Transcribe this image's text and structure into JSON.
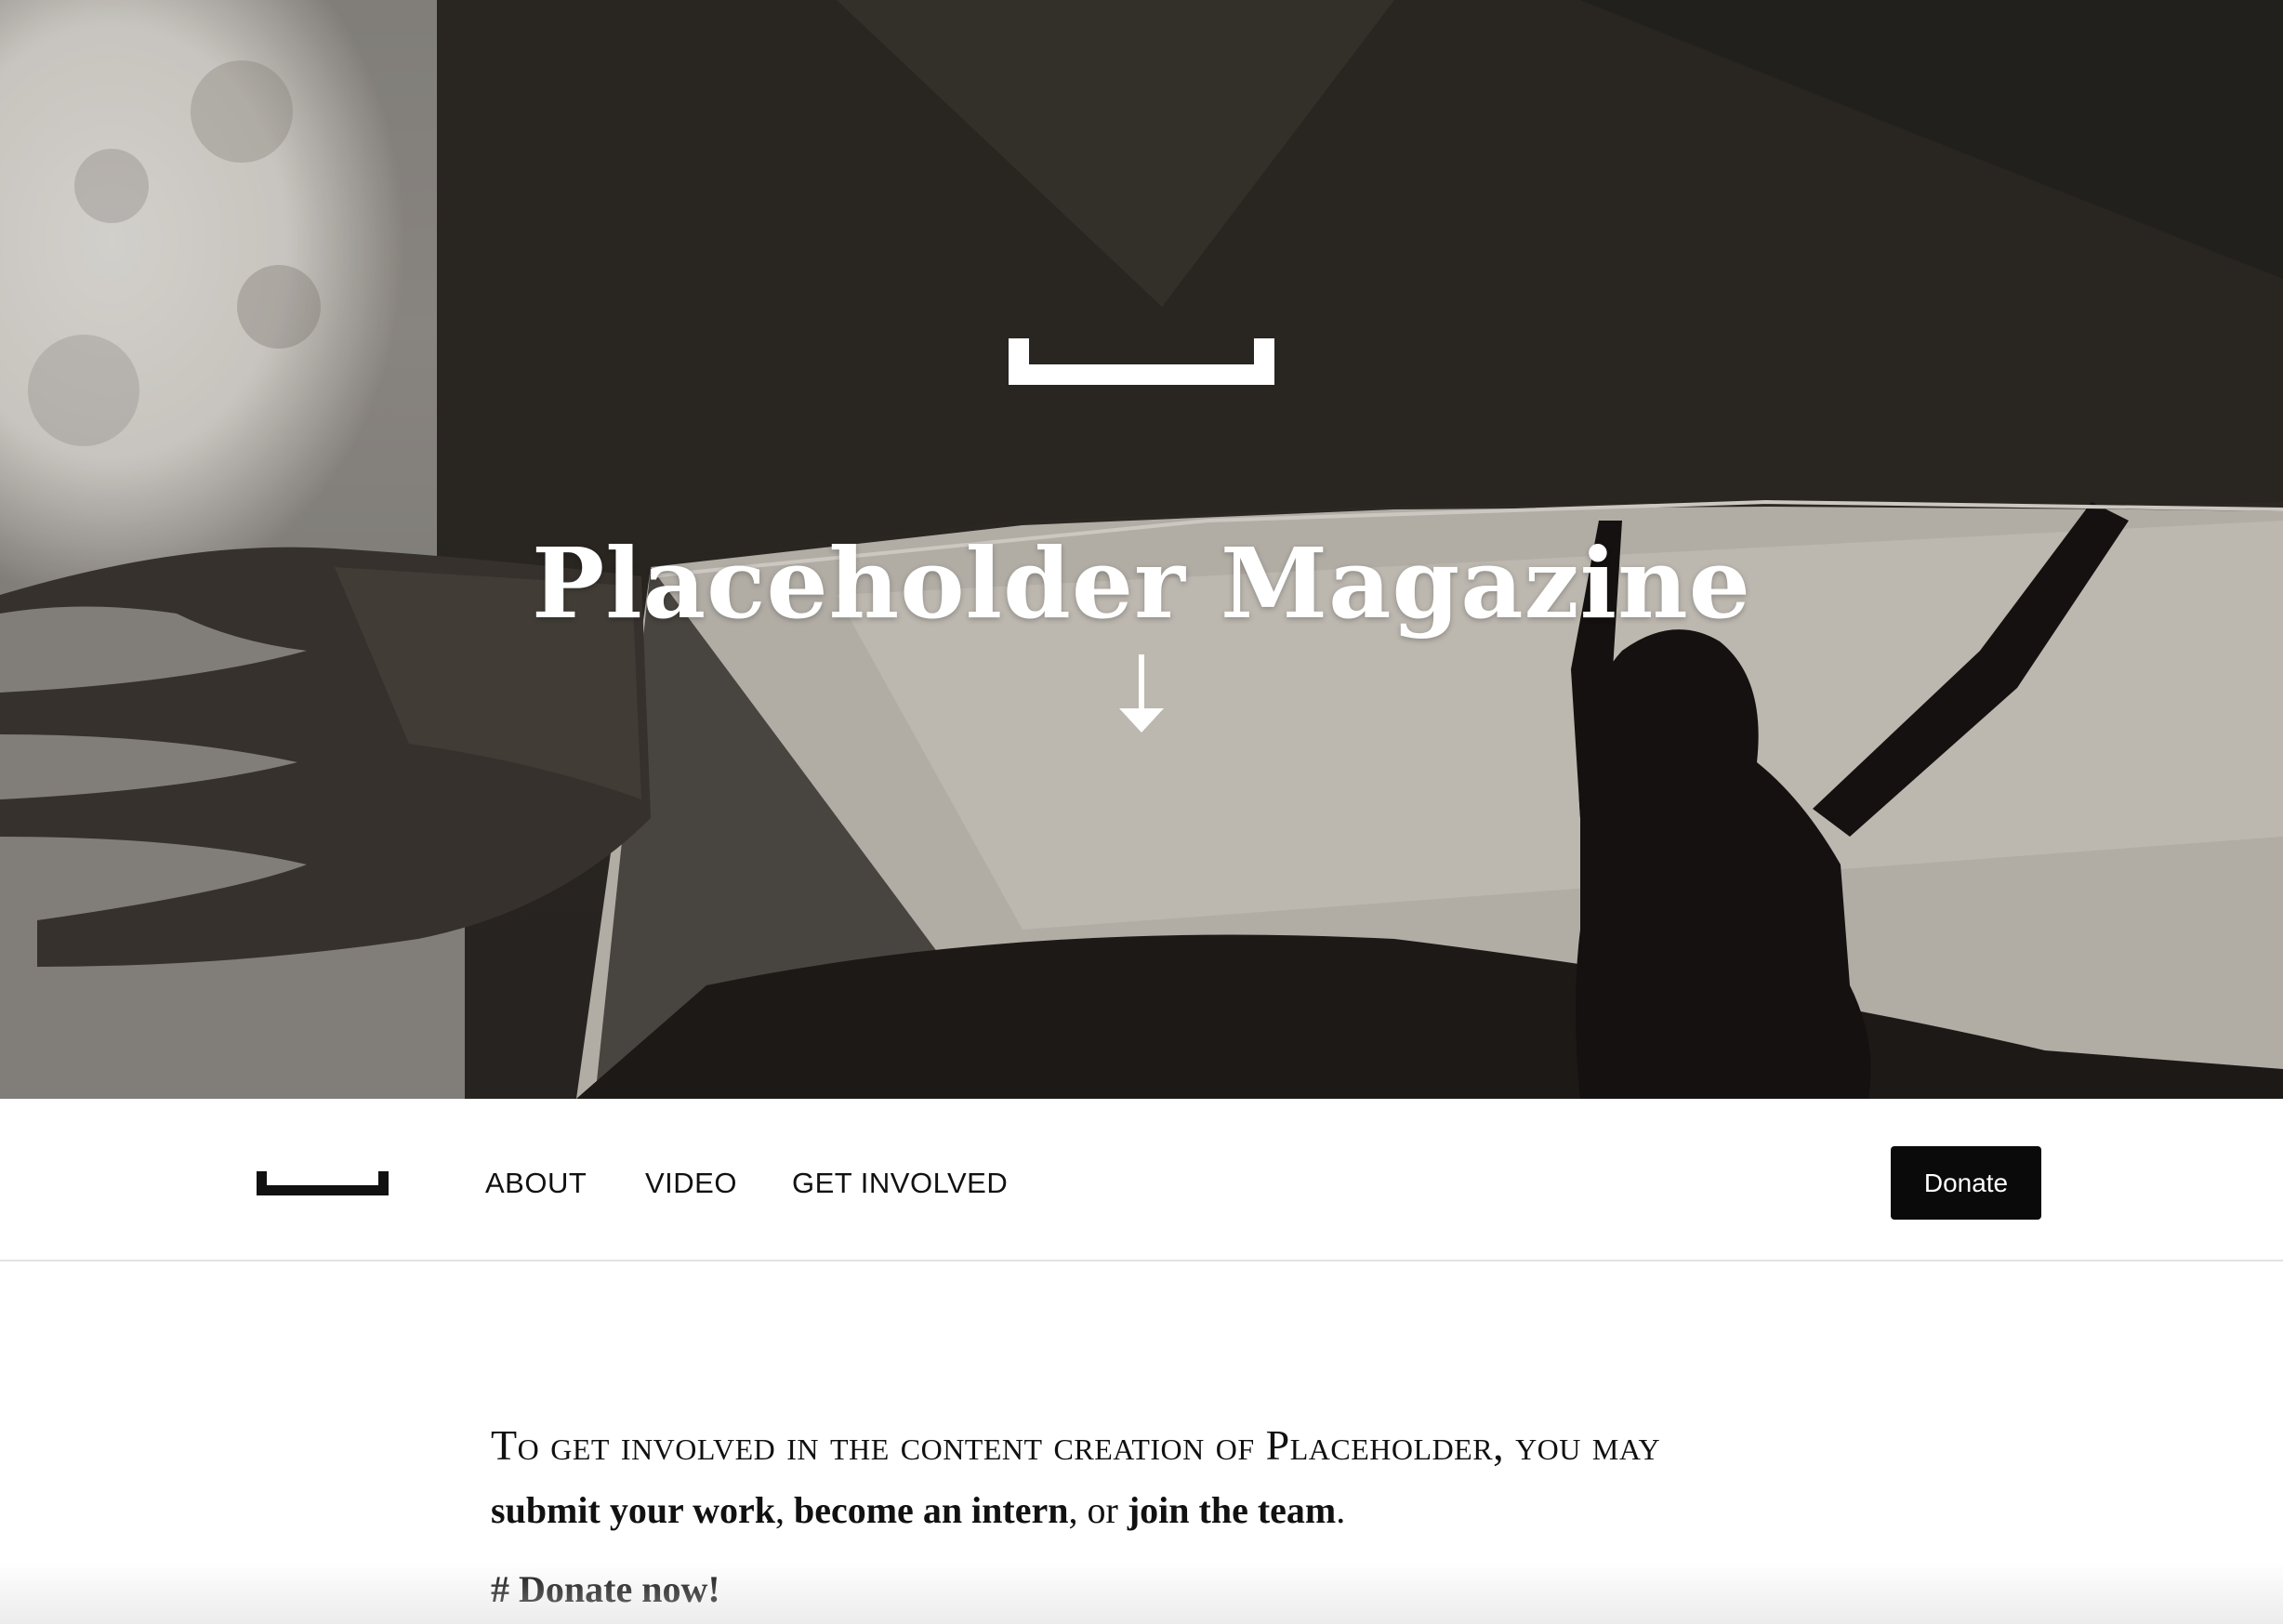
{
  "hero": {
    "title": "Placeholder Magazine",
    "logo_icon": "bracket-logo-icon",
    "scroll_icon": "arrow-down-icon"
  },
  "nav": {
    "logo_icon": "bracket-logo-icon",
    "links": [
      "ABOUT",
      "VIDEO",
      "GET INVOLVED"
    ],
    "donate_label": "Donate"
  },
  "content": {
    "intro": "To get involved in the content creation of Placeholder, you may",
    "links": [
      "submit your work",
      "become an intern",
      "join the team"
    ],
    "separator_1": ", ",
    "separator_2": ", or ",
    "end": ".",
    "donate_heading": "# Donate now!"
  },
  "colors": {
    "text": "#111111",
    "button_bg": "#0a0a0a",
    "button_text": "#ffffff",
    "hero_text": "#ffffff"
  }
}
